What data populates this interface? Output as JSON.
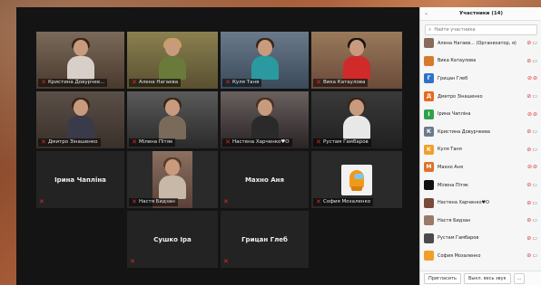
{
  "panel": {
    "title": "Участники (14)",
    "search_placeholder": "Найти участника",
    "participants": [
      {
        "name": "Алена Нагаев... (Организатор, я)",
        "avatar_color": "#8a6a5a",
        "avatar_letter": ""
      },
      {
        "name": "Вика Катаулова",
        "avatar_color": "#d67a2c",
        "avatar_letter": ""
      },
      {
        "name": "Грицан Глеб",
        "avatar_color": "#2f72c8",
        "avatar_letter": "Г"
      },
      {
        "name": "Дмитро Зінашенко",
        "avatar_color": "#e56a1c",
        "avatar_letter": "Д"
      },
      {
        "name": "Ірина Чапліна",
        "avatar_color": "#2ea24a",
        "avatar_letter": "І"
      },
      {
        "name": "Кристина Довурчеева",
        "avatar_color": "#6a7a8a",
        "avatar_letter": "К"
      },
      {
        "name": "Куля Таня",
        "avatar_color": "#f0a02a",
        "avatar_letter": "К"
      },
      {
        "name": "Махно Аня",
        "avatar_color": "#e0702a",
        "avatar_letter": "М"
      },
      {
        "name": "Мілена Пітяк",
        "avatar_color": "#111111",
        "avatar_letter": ""
      },
      {
        "name": "Настена Харченко♥О",
        "avatar_color": "#7a4a3a",
        "avatar_letter": ""
      },
      {
        "name": "Настя Бидзан",
        "avatar_color": "#9a7a6a",
        "avatar_letter": ""
      },
      {
        "name": "Рустам Гамбаров",
        "avatar_color": "#4a4a4a",
        "avatar_letter": ""
      },
      {
        "name": "София Мозаленко",
        "avatar_color": "#f0a02a",
        "avatar_letter": ""
      }
    ],
    "invite_label": "Пригласить",
    "mute_all_label": "Выкл. весь звук",
    "more_label": "..."
  },
  "tiles": [
    {
      "name": "Кристина Довурчее...",
      "camera": true,
      "active": false,
      "bg": "#5a4a3a"
    },
    {
      "name": "Алена Нагаева",
      "camera": true,
      "active": true,
      "bg": "#6a6040"
    },
    {
      "name": "Куля Таня",
      "camera": true,
      "active": false,
      "bg": "#4a5a6a"
    },
    {
      "name": "Вика Катаулова",
      "camera": true,
      "active": false,
      "bg": "#7a5a4a"
    },
    {
      "name": "Дмитро Зінашенко",
      "camera": true,
      "active": false,
      "bg": "#5a5048"
    },
    {
      "name": "Мілена Пітяк",
      "camera": true,
      "active": false,
      "bg": "#4a4a4a"
    },
    {
      "name": "Настена Харченко♥О",
      "camera": true,
      "active": false,
      "bg": "#504848"
    },
    {
      "name": "Рустам Гамбаров",
      "camera": true,
      "active": false,
      "bg": "#3a3a3a"
    },
    {
      "name": "Ірина Чапліна",
      "camera": false,
      "active": false
    },
    {
      "name": "Настя Бидзан",
      "camera": true,
      "active": false,
      "bg": "#5a4a48"
    },
    {
      "name": "Махно Аня",
      "camera": false,
      "active": false
    },
    {
      "name": "София Мозаленко",
      "camera": true,
      "active": false,
      "avatar": "amongus-avatar"
    },
    {
      "name": "Сушко Іра",
      "camera": false,
      "active": false
    },
    {
      "name": "Грицан Глеб",
      "camera": false,
      "active": false
    }
  ],
  "colors": {
    "mic_muted": "#e02a2a",
    "active_speaker": "#c8e000"
  }
}
